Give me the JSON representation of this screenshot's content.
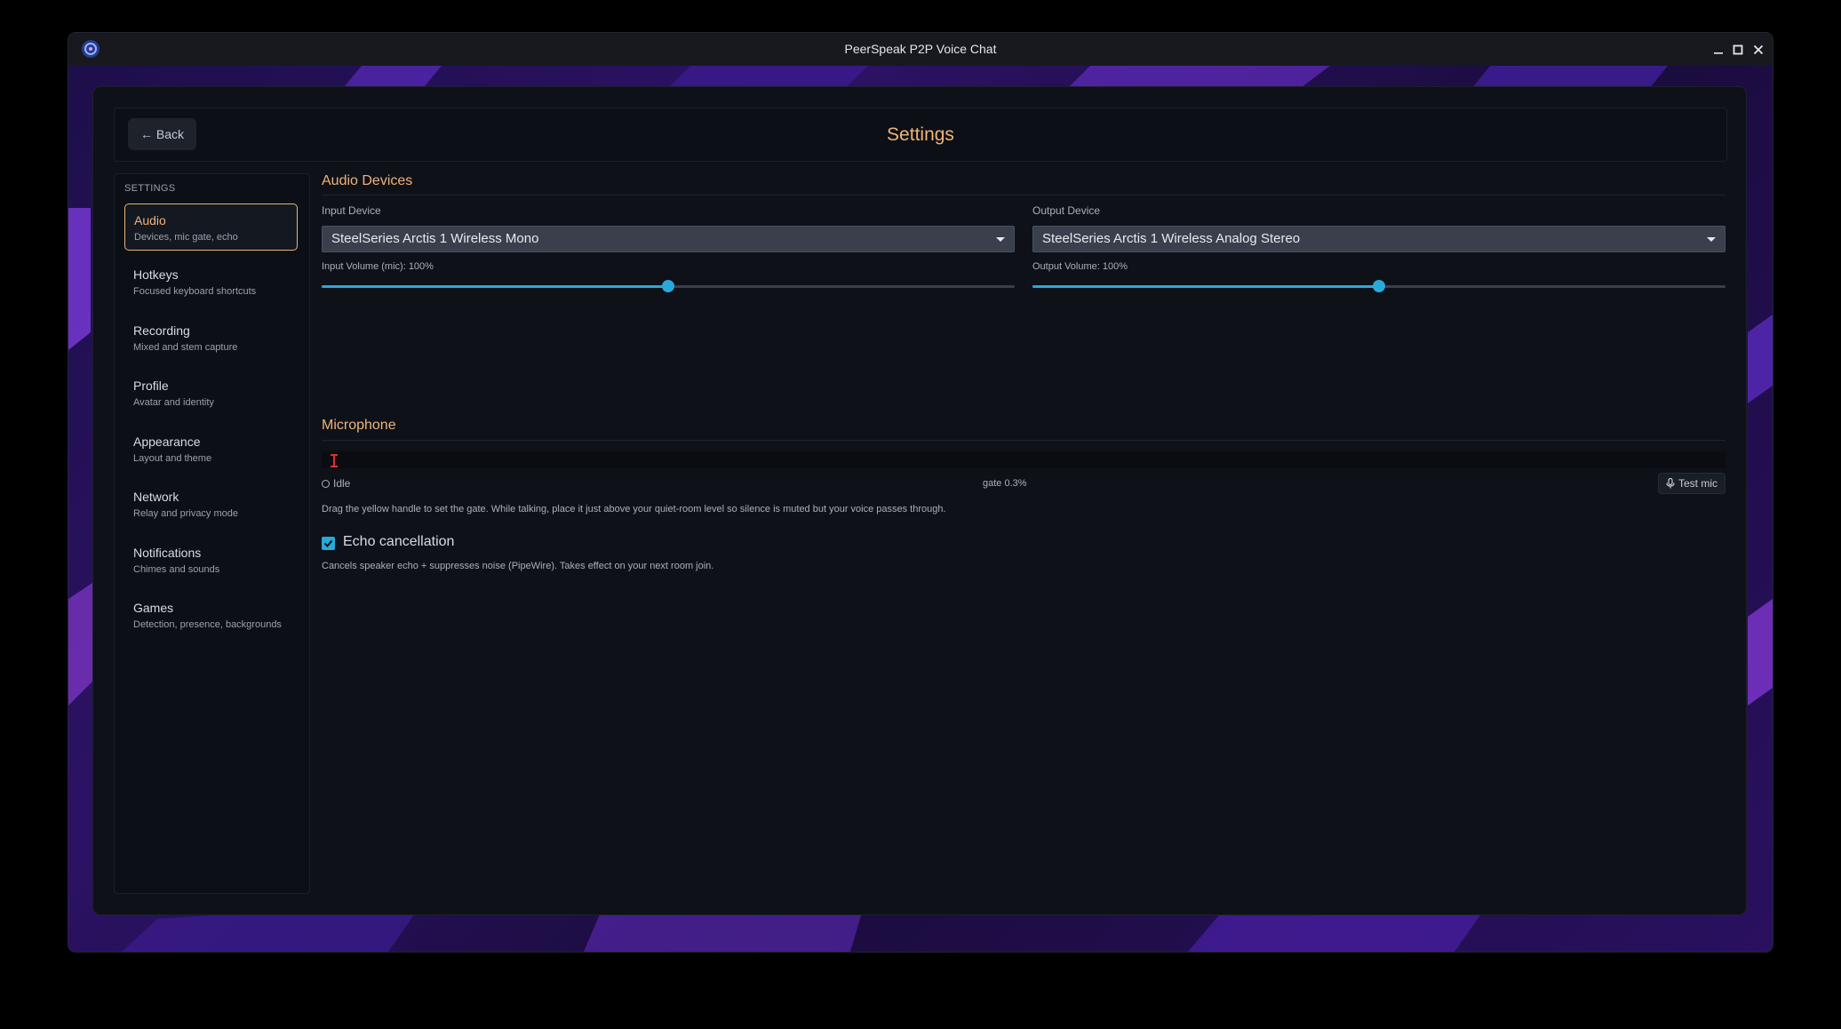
{
  "window": {
    "title": "PeerSpeak P2P Voice Chat",
    "icons": {
      "app": "app-logo-icon",
      "minimize": "minimize-icon",
      "maximize": "maximize-icon",
      "close": "close-icon"
    }
  },
  "header": {
    "back_label": "← Back",
    "title": "Settings"
  },
  "sidebar": {
    "heading": "SETTINGS",
    "items": [
      {
        "label": "Audio",
        "sub": "Devices, mic gate, echo",
        "active": true
      },
      {
        "label": "Hotkeys",
        "sub": "Focused keyboard shortcuts"
      },
      {
        "label": "Recording",
        "sub": "Mixed and stem capture"
      },
      {
        "label": "Profile",
        "sub": "Avatar and identity"
      },
      {
        "label": "Appearance",
        "sub": "Layout and theme"
      },
      {
        "label": "Network",
        "sub": "Relay and privacy mode"
      },
      {
        "label": "Notifications",
        "sub": "Chimes and sounds"
      },
      {
        "label": "Games",
        "sub": "Detection, presence, backgrounds"
      }
    ]
  },
  "audio_devices": {
    "title": "Audio Devices",
    "input": {
      "label": "Input Device",
      "value": "SteelSeries Arctis 1 Wireless Mono",
      "volume_label": "Input Volume (mic): 100%",
      "volume_fraction": 0.5
    },
    "output": {
      "label": "Output Device",
      "value": "SteelSeries Arctis 1 Wireless Analog Stereo",
      "volume_label": "Output Volume: 100%",
      "volume_fraction": 0.5
    }
  },
  "microphone": {
    "title": "Microphone",
    "gate_fraction": 0.009,
    "status": "Idle",
    "gate_label": "gate 0.3%",
    "test_mic_label": "Test mic",
    "help": "Drag the yellow handle to set the gate. While talking, place it just above your quiet-room level so silence is muted but your voice passes through.",
    "echo": {
      "label": "Echo cancellation",
      "checked": true,
      "help": "Cancels speaker echo + suppresses noise (PipeWire). Takes effect on your next room join."
    }
  },
  "colors": {
    "accent": "#f0b37a",
    "slider": "#2aa8d8",
    "gate_handle": "#e03030"
  }
}
